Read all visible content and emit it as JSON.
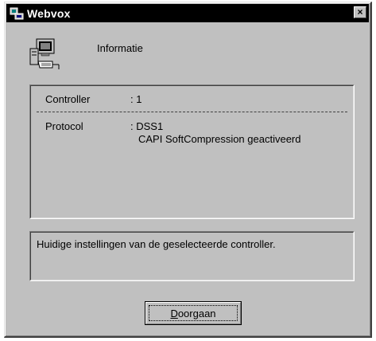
{
  "window": {
    "title": "Webvox",
    "close_glyph": "×"
  },
  "header": {
    "icon": "network-computer-icon",
    "label": "Informatie"
  },
  "info": {
    "controller_label": "Controller",
    "controller_value": ": 1",
    "protocol_label": "Protocol",
    "protocol_value_1": ": DSS1",
    "protocol_value_2": "CAPI SoftCompression geactiveerd"
  },
  "status": {
    "text": "Huidige instellingen van de geselecteerde controller."
  },
  "buttons": {
    "continue_accel": "D",
    "continue_rest": "oorgaan"
  }
}
